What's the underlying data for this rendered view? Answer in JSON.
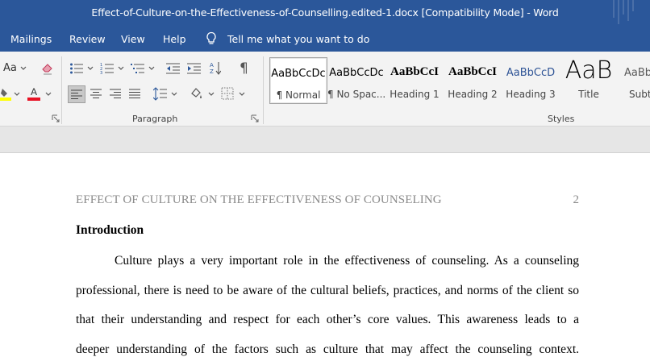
{
  "window": {
    "title": "Effect-of-Culture-on-the-Effectiveness-of-Counselling.edited-1.docx [Compatibility Mode]  -  Word"
  },
  "tabs": {
    "mailings": "Mailings",
    "review": "Review",
    "view": "View",
    "help": "Help",
    "tell_me": "Tell me what you want to do"
  },
  "ribbon": {
    "font": {
      "change_case_label": "Aa"
    },
    "paragraph": {
      "label": "Paragraph"
    },
    "styles": {
      "label": "Styles",
      "items": [
        {
          "preview": "AaBbCcDc",
          "name": "¶ Normal"
        },
        {
          "preview": "AaBbCcDc",
          "name": "¶ No Spac..."
        },
        {
          "preview": "AaBbCcI",
          "name": "Heading 1"
        },
        {
          "preview": "AaBbCcI",
          "name": "Heading 2"
        },
        {
          "preview": "AaBbCcD",
          "name": "Heading 3"
        },
        {
          "preview": "AaB",
          "name": "Title"
        },
        {
          "preview": "AaBb",
          "name": "Subtitle"
        }
      ]
    },
    "colors": {
      "highlight": "#ffff00",
      "font_color": "#e81123",
      "accent": "#2b579a"
    }
  },
  "document": {
    "header_title": "EFFECT OF CULTURE ON THE EFFECTIVENESS OF COUNSELING",
    "page_number": "2",
    "heading": "Introduction",
    "lines": [
      "Culture plays a very important role in the effectiveness of counseling. As a counseling",
      "professional, there is need to be aware of the cultural beliefs, practices, and norms of the client so",
      "that their understanding and respect for each other’s core values. This awareness leads to a",
      "deeper understanding of the factors such as culture that may affect the counseling context."
    ]
  }
}
